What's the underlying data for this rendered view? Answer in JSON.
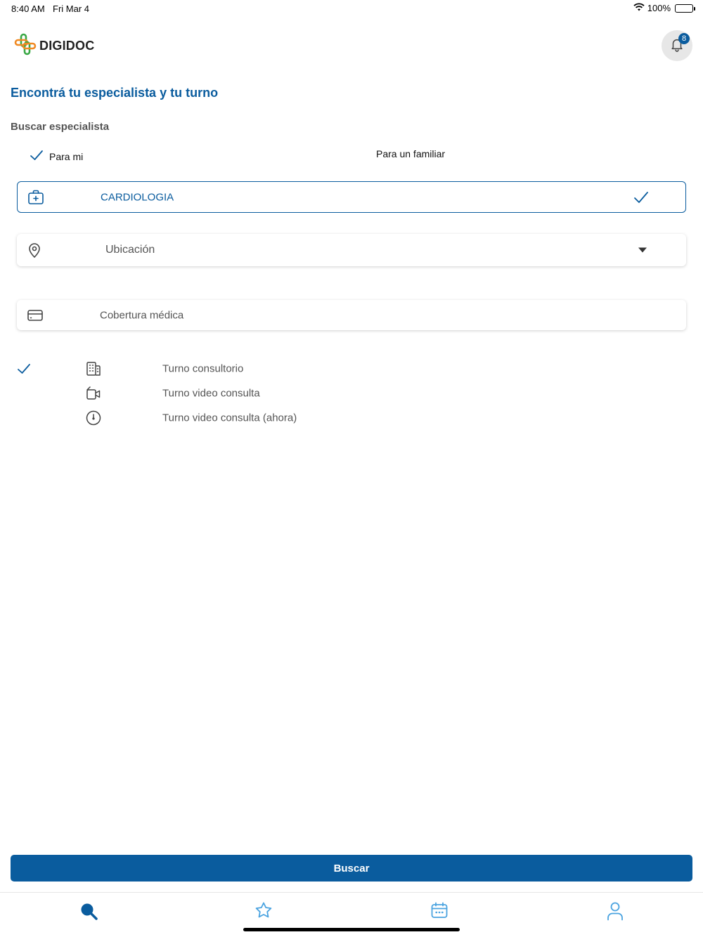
{
  "status_bar": {
    "time": "8:40 AM",
    "date": "Fri Mar 4",
    "battery": "100%"
  },
  "header": {
    "logo_text": "DIGIDOC",
    "notification_count": "8"
  },
  "title": "Encontrá tu especialista y tu turno",
  "search": {
    "section_label": "Buscar especialista",
    "patient_options": [
      {
        "label": "Para mi",
        "selected": true
      },
      {
        "label": "Para un familiar",
        "selected": false
      }
    ],
    "specialty": {
      "value": "CARDIOLOGIA",
      "icon": "medical-case-icon"
    },
    "location": {
      "placeholder": "Ubicación",
      "icon": "location-pin-icon"
    },
    "coverage": {
      "placeholder": "Cobertura médica",
      "icon": "credit-card-icon"
    }
  },
  "appointment_types": [
    {
      "label": "Turno consultorio",
      "icon": "building-icon",
      "selected": true
    },
    {
      "label": "Turno video consulta",
      "icon": "video-camera-icon",
      "selected": false
    },
    {
      "label": "Turno video consulta (ahora)",
      "icon": "clock-icon",
      "selected": false
    }
  ],
  "actions": {
    "search_label": "Buscar"
  },
  "tab_bar": [
    {
      "name": "search",
      "icon": "search-icon",
      "active": true
    },
    {
      "name": "favorites",
      "icon": "star-icon",
      "active": false
    },
    {
      "name": "calendar",
      "icon": "calendar-icon",
      "active": false
    },
    {
      "name": "profile",
      "icon": "user-icon",
      "active": false
    }
  ],
  "colors": {
    "primary": "#0a5c9e",
    "tab_inactive": "#4aa3e0",
    "logo_orange": "#f08a24",
    "logo_green": "#3aa846"
  }
}
